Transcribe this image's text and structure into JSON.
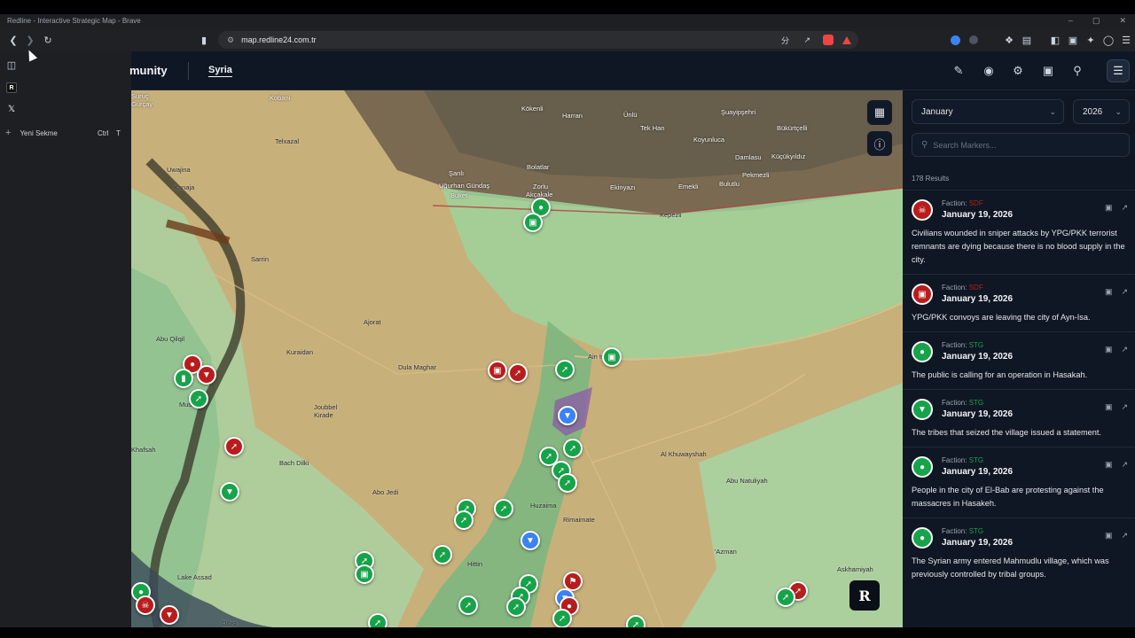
{
  "window": {
    "title": "Redline - Interactive Strategic Map - Brave",
    "controls": [
      "–",
      "▢",
      "✕"
    ]
  },
  "browser": {
    "url": "map.redline24.com.tr"
  },
  "browser_sidebar": {
    "new_tab_label": "Yeni Sekme",
    "new_tab_shortcut_ctrl": "Ctrl",
    "new_tab_shortcut_key": "T"
  },
  "header": {
    "brand": "munity",
    "active_tab": "Syria"
  },
  "filters": {
    "month": "January",
    "year": "2026",
    "search_placeholder": "Search Markers...",
    "results": "178 Results"
  },
  "feed": [
    {
      "faction": "SDF",
      "color": "#b91c1c",
      "icon": "skull-icon",
      "date": "January 19, 2026",
      "text": "Civilians wounded in sniper attacks by YPG/PKK terrorist remnants are dying because there is no blood supply in the city."
    },
    {
      "faction": "SDF",
      "color": "#b91c1c",
      "icon": "truck-icon",
      "date": "January 19, 2026",
      "text": "YPG/PKK convoys are leaving the city of Ayn-Isa."
    },
    {
      "faction": "STG",
      "color": "#16a34a",
      "icon": "people-icon",
      "date": "January 19, 2026",
      "text": "The public is calling for an operation in Hasakah."
    },
    {
      "faction": "STG",
      "color": "#16a34a",
      "icon": "megaphone-icon",
      "date": "January 19, 2026",
      "text": "The tribes that seized the village issued a statement."
    },
    {
      "faction": "STG",
      "color": "#16a34a",
      "icon": "people-icon",
      "date": "January 19, 2026",
      "text": "People in the city of El-Bab are protesting against the massacres in Hasakeh."
    },
    {
      "faction": "STG",
      "color": "#16a34a",
      "icon": "people-icon",
      "date": "January 19, 2026",
      "text": "The Syrian army entered Mahmudlu village, which was previously controlled by tribal groups."
    }
  ],
  "faction_label": "Faction:",
  "map_labels": {
    "kobani": "Kobani",
    "surucgur": "Suruç\nGurçay",
    "harran": "Harran",
    "unlu": "Ünlü",
    "kokenli": "Kökenli",
    "tekhan": "Tek Han",
    "koyunluca": "Koyunluca",
    "suayipsehri": "Şuayipşehri",
    "bukurtcelli": "Bükürtçelli",
    "damlasu": "Damlasu",
    "kucukyildiz": "Küçükyıldız",
    "pekmezli": "Pekmezli",
    "bulutlu": "Bulutlu",
    "emekli": "Emekli",
    "ekinyazi": "Ekinyazı",
    "kepezli": "Kepezli",
    "bolatlar": "Bolatlar",
    "zorlu": "Zorlu",
    "akcakale": "Akçakale",
    "sanli": "Şanlı",
    "ugurhan": "Uğurhan Gündaş",
    "buket": "Buket",
    "telxazal": "Telxazal",
    "uwajina": "Uwajina",
    "kanaja": "Kanaja",
    "sarrin": "Sarrin",
    "ajorat": "Ajorat",
    "kuraidan": "Kuraidan",
    "dulamaghar": "Dula Maghar",
    "joubbel": "Joubbel\nKirade",
    "abuqilqil": "Abu Qilqil",
    "mustaha": "Mustaha",
    "khafsah": "Khafsah",
    "bachdilki": "Bach Dilki",
    "abojedi": "Abo Jedi",
    "lakeassad": "Lake Assad",
    "dibsi": "Dibsi",
    "hittin": "Hittin",
    "huzaima": "Huzaima",
    "rimaimate": "Rimaimate",
    "alkhuwayshah": "Al Khuwayshah",
    "abunatuliyah": "Abu Natuliyah",
    "azman": "'Azman",
    "askhamiyah": "Askhamiyah",
    "ainissa": "Ain Issa"
  },
  "colors": {
    "sdf": "#b91c1c",
    "stg": "#16a34a",
    "gov": "#3b82f6",
    "page_bg": "#0f1724"
  }
}
